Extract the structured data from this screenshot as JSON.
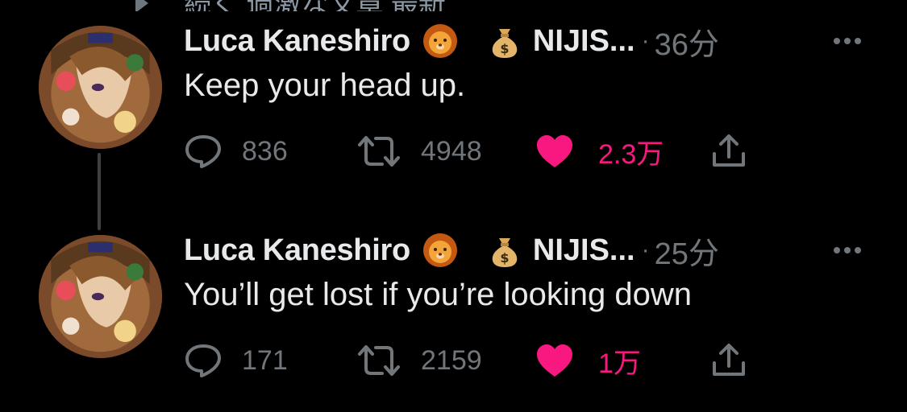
{
  "top_fragment": {
    "text": "続く 過激な文章 最新"
  },
  "tweets": [
    {
      "author": {
        "display_name": "Luca Kaneshiro",
        "badge_1": "lion-emoji",
        "badge_2": "money-bag-emoji",
        "affiliation": "NIJIS..."
      },
      "separator": "·",
      "time": "36分",
      "text": "Keep your head up.",
      "stats": {
        "replies": "836",
        "retweets": "4948",
        "likes": "2.3万"
      },
      "liked": true
    },
    {
      "author": {
        "display_name": "Luca Kaneshiro",
        "badge_1": "lion-emoji",
        "badge_2": "money-bag-emoji",
        "affiliation": "NIJIS..."
      },
      "separator": "·",
      "time": "25分",
      "text": "You’ll get lost if you’re looking down",
      "stats": {
        "replies": "171",
        "retweets": "2159",
        "likes": "1万"
      },
      "liked": true
    }
  ],
  "colors": {
    "background": "#000000",
    "text_primary": "#e7e9ea",
    "text_secondary": "#71767b",
    "like_active": "#f91880",
    "thread_line": "#3e4144"
  }
}
